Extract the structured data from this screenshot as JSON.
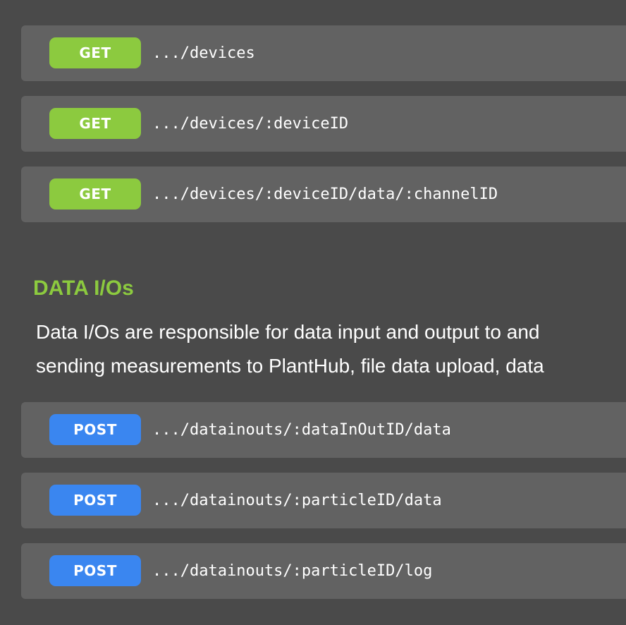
{
  "colors": {
    "background": "#4a4a4a",
    "row": "#626262",
    "get": "#8cca3f",
    "post": "#3a86f0",
    "title": "#8cca3f"
  },
  "devices_endpoints": [
    {
      "method": "GET",
      "path": ".../devices"
    },
    {
      "method": "GET",
      "path": ".../devices/:deviceID"
    },
    {
      "method": "GET",
      "path": ".../devices/:deviceID/data/:channelID"
    }
  ],
  "data_ios": {
    "title": "DATA I/Os",
    "description_lines": [
      "Data I/Os are responsible for data input and output to and",
      "sending measurements to PlantHub, file data upload, data"
    ],
    "endpoints": [
      {
        "method": "POST",
        "path": ".../datainouts/:dataInOutID/data"
      },
      {
        "method": "POST",
        "path": ".../datainouts/:particleID/data"
      },
      {
        "method": "POST",
        "path": ".../datainouts/:particleID/log"
      }
    ]
  }
}
